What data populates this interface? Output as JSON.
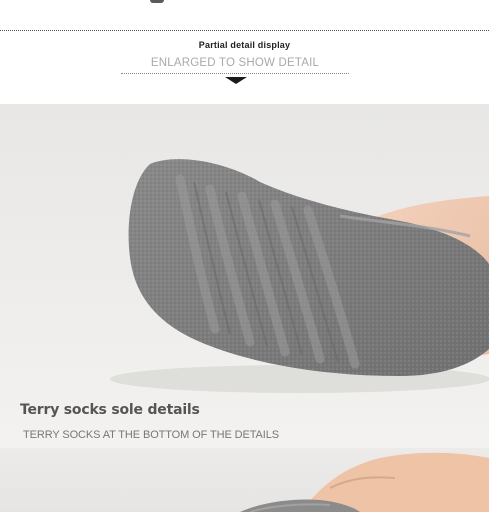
{
  "header": {
    "title": "Partial detail display",
    "subtitle": "ENLARGED TO SHOW DETAIL"
  },
  "detail": {
    "caption_title": "Terry socks sole details",
    "caption_subtitle": "TERRY SOCKS AT THE BOTTOM OF THE DETAILS"
  },
  "colors": {
    "sock_gray": "#7f7f80",
    "skin": "#f0c9b0",
    "background": "#eeedeb"
  }
}
